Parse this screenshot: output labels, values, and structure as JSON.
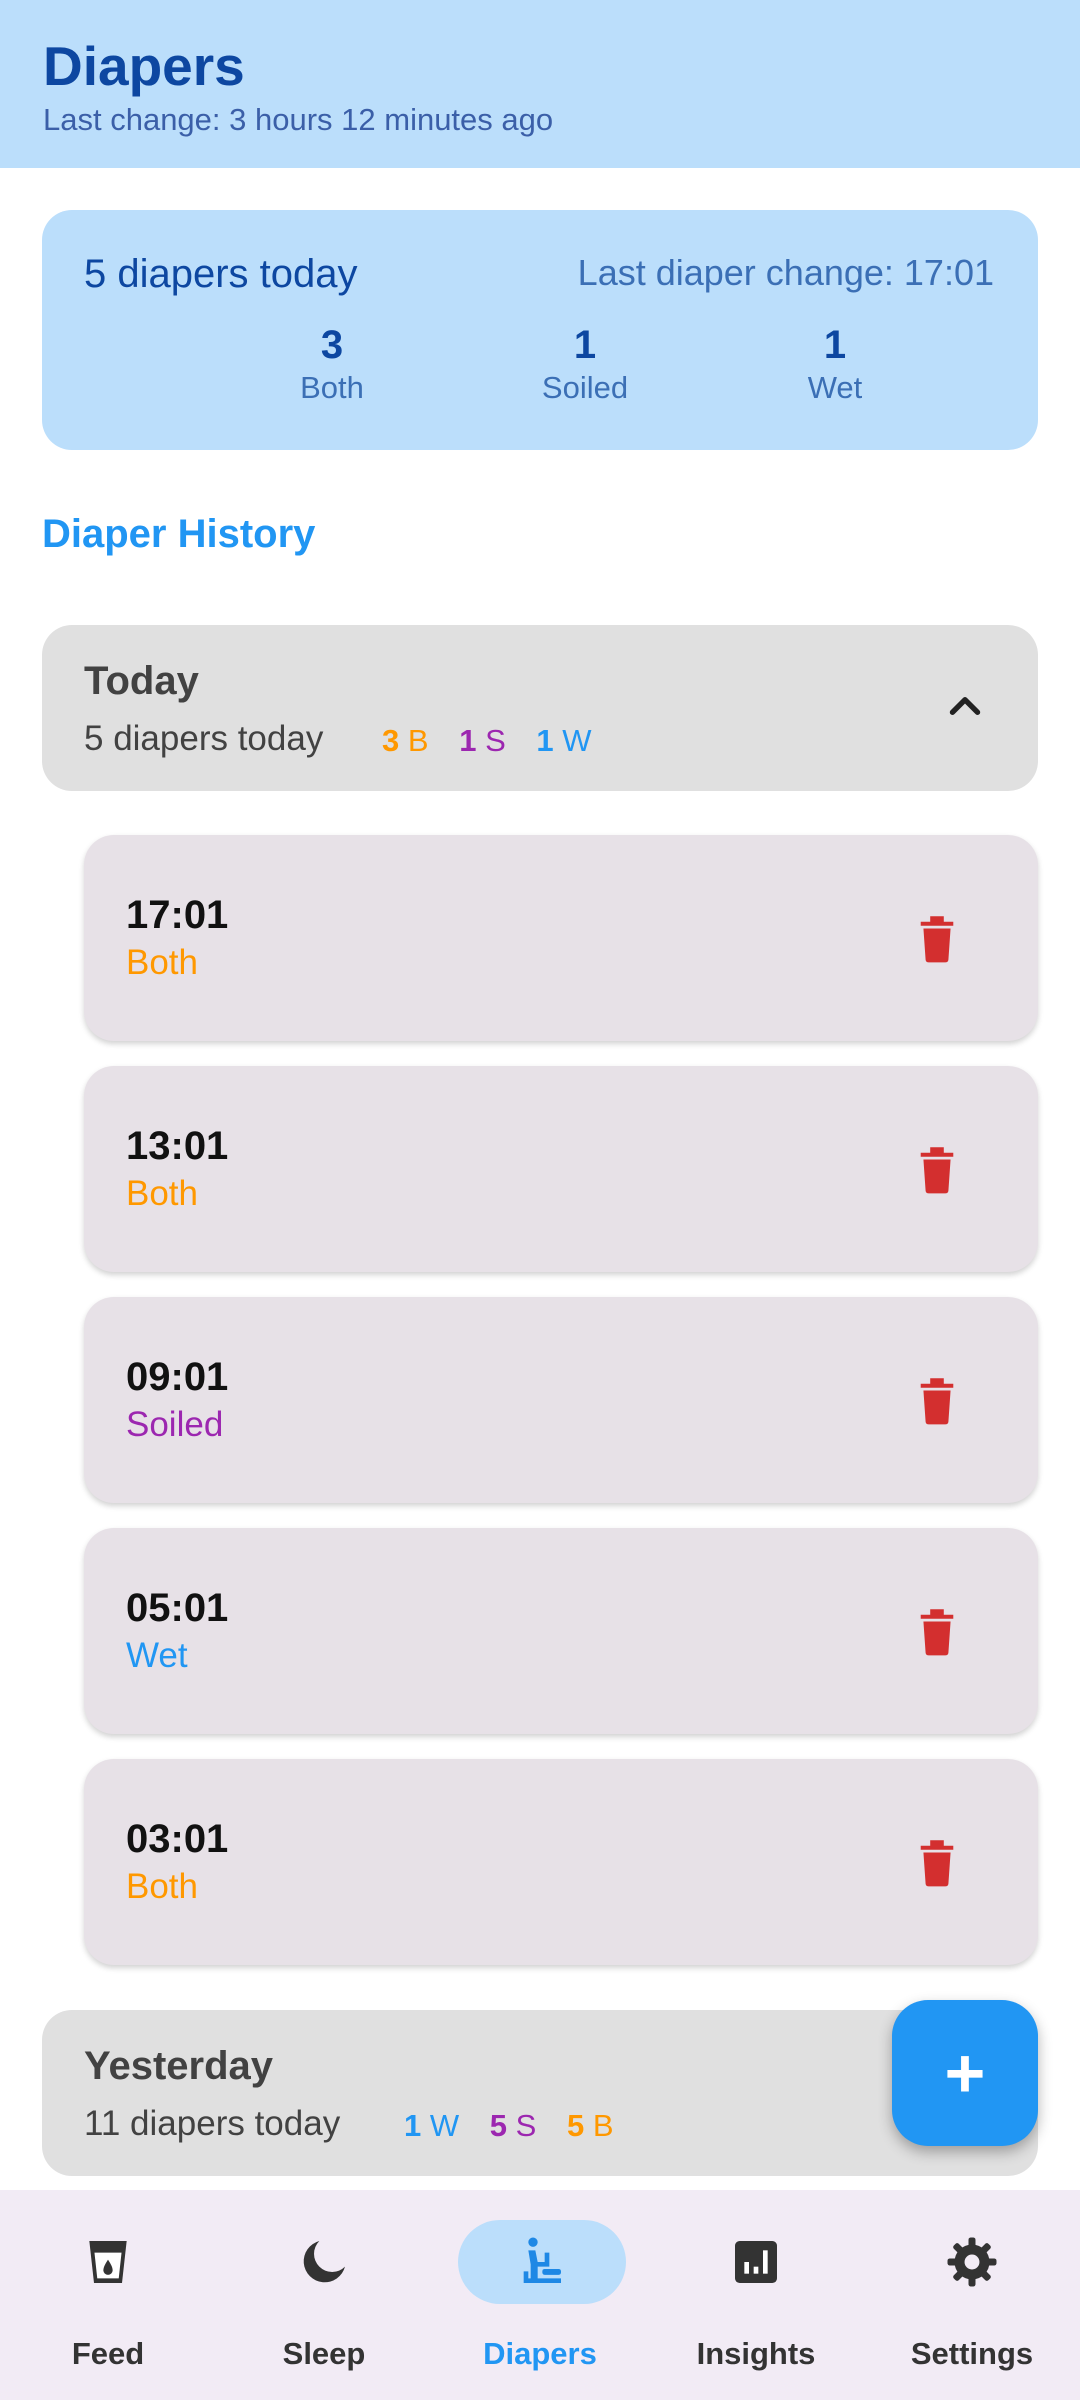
{
  "header": {
    "title": "Diapers",
    "subtitle": "Last change: 3 hours 12 minutes ago"
  },
  "summary": {
    "count": "5 diapers today",
    "last_change": "Last diaper change: 17:01",
    "stats": [
      {
        "value": "3",
        "label": "Both"
      },
      {
        "value": "1",
        "label": "Soiled"
      },
      {
        "value": "1",
        "label": "Wet"
      }
    ]
  },
  "history_title": "Diaper History",
  "groups": [
    {
      "title": "Today",
      "count": "5 diapers today",
      "badges": [
        {
          "n": "3",
          "l": "B",
          "color": "#ff9800"
        },
        {
          "n": "1",
          "l": "S",
          "color": "#9c27b0"
        },
        {
          "n": "1",
          "l": "W",
          "color": "#2196f3"
        }
      ],
      "entries": [
        {
          "time": "17:01",
          "type": "Both",
          "color": "#ff9800"
        },
        {
          "time": "13:01",
          "type": "Both",
          "color": "#ff9800"
        },
        {
          "time": "09:01",
          "type": "Soiled",
          "color": "#9c27b0"
        },
        {
          "time": "05:01",
          "type": "Wet",
          "color": "#2196f3"
        },
        {
          "time": "03:01",
          "type": "Both",
          "color": "#ff9800"
        }
      ]
    },
    {
      "title": "Yesterday",
      "count": "11 diapers today",
      "badges": [
        {
          "n": "1",
          "l": "W",
          "color": "#2196f3"
        },
        {
          "n": "5",
          "l": "S",
          "color": "#9c27b0"
        },
        {
          "n": "5",
          "l": "B",
          "color": "#ff9800"
        }
      ]
    }
  ],
  "fab_icon": "plus-icon",
  "nav": [
    {
      "label": "Feed",
      "icon": "feed-icon"
    },
    {
      "label": "Sleep",
      "icon": "moon-icon"
    },
    {
      "label": "Diapers",
      "icon": "baby-changing-icon",
      "active": true
    },
    {
      "label": "Insights",
      "icon": "insights-icon"
    },
    {
      "label": "Settings",
      "icon": "gear-icon"
    }
  ]
}
